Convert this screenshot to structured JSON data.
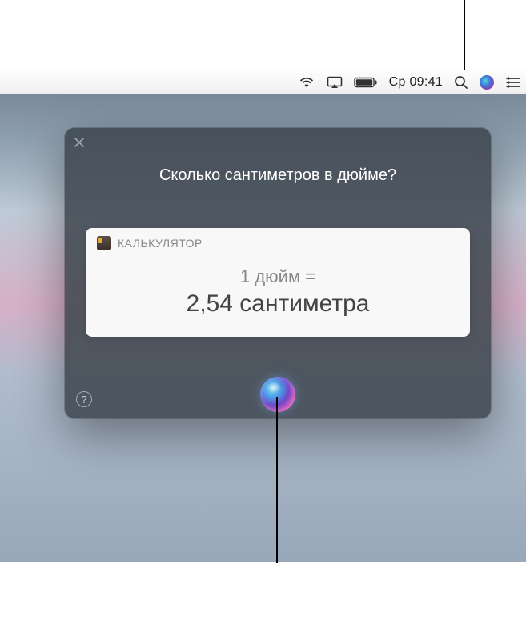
{
  "menubar": {
    "datetime": "Ср 09:41"
  },
  "siri": {
    "question": "Сколько сантиметров в дюйме?",
    "card": {
      "app_name": "КАЛЬКУЛЯТОР",
      "line1": "1 дюйм =",
      "line2": "2,54 сантиметра"
    },
    "help_label": "?"
  }
}
